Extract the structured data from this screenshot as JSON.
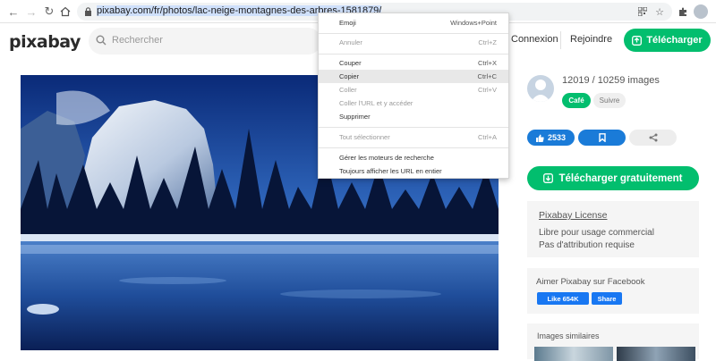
{
  "browser": {
    "url": "pixabay.com/fr/photos/lac-neige-montagnes-des-arbres-1581879/"
  },
  "header": {
    "logo": "pixabay",
    "search_placeholder": "Rechercher",
    "login": "Connexion",
    "join": "Rejoindre",
    "upload": "Télécharger"
  },
  "context_menu": {
    "items": [
      {
        "label": "Emoji",
        "shortcut": "Windows+Point"
      },
      {
        "label": "Annuler",
        "shortcut": "Ctrl+Z"
      },
      {
        "label": "Couper",
        "shortcut": "Ctrl+X"
      },
      {
        "label": "Copier",
        "shortcut": "Ctrl+C"
      },
      {
        "label": "Coller",
        "shortcut": "Ctrl+V"
      },
      {
        "label": "Coller l'URL et y accéder",
        "shortcut": ""
      },
      {
        "label": "Supprimer",
        "shortcut": ""
      },
      {
        "label": "Tout sélectionner",
        "shortcut": "Ctrl+A"
      },
      {
        "label": "Gérer les moteurs de recherche",
        "shortcut": ""
      },
      {
        "label": "Toujours afficher les URL en entier",
        "shortcut": ""
      }
    ]
  },
  "profile": {
    "stats": "12019 / 10259 images",
    "coffee": "Café",
    "follow": "Suivre"
  },
  "actions": {
    "likes": "2533"
  },
  "download": {
    "label": "Télécharger gratuitement"
  },
  "license": {
    "title": "Pixabay License",
    "line1": "Libre pour usage commercial",
    "line2": "Pas d'attribution requise"
  },
  "facebook": {
    "title": "Aimer Pixabay sur Facebook",
    "like": "Like 654K",
    "share": "Share"
  },
  "similar": {
    "title": "Images similaires"
  },
  "colors": {
    "accent": "#02be6e",
    "action_blue": "#1a7bd8",
    "facebook": "#1877f2"
  }
}
